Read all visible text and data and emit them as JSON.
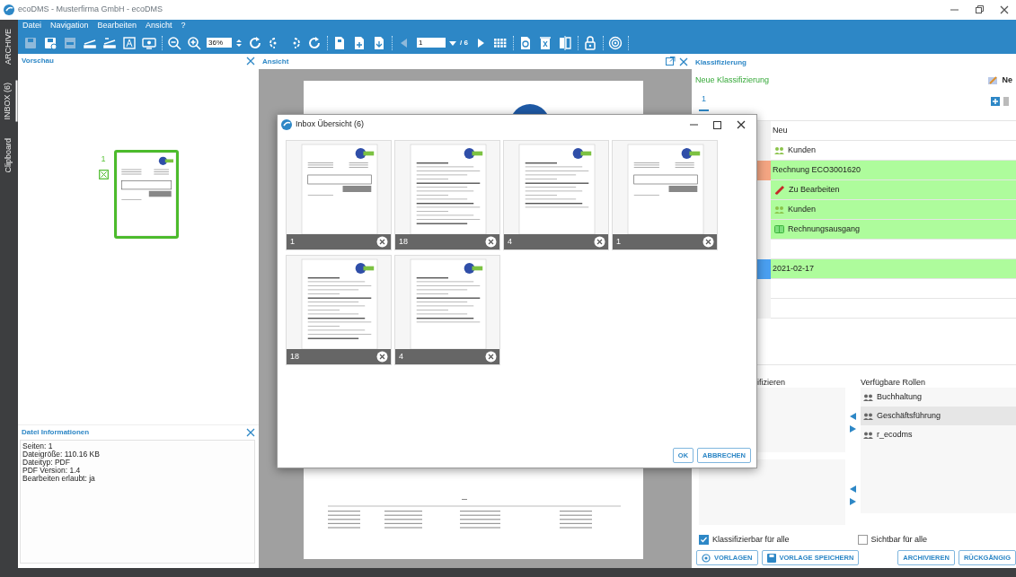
{
  "window": {
    "title": "ecoDMS - Musterfirma GmbH - ecoDMS"
  },
  "side_tabs": [
    {
      "label": "ARCHIVE",
      "selected": false
    },
    {
      "label": "INBOX (6)",
      "selected": true
    },
    {
      "label": "Clipboard",
      "selected": false
    }
  ],
  "menu": [
    "Datei",
    "Navigation",
    "Bearbeiten",
    "Ansicht",
    "?"
  ],
  "toolbar": {
    "groups": [
      [
        {
          "kind": "save",
          "disabled": true
        },
        {
          "kind": "save-as",
          "disabled": false
        },
        {
          "kind": "pdf",
          "disabled": true
        },
        {
          "kind": "scan",
          "disabled": false
        },
        {
          "kind": "scan-add",
          "disabled": false
        },
        {
          "kind": "ocr",
          "disabled": false
        },
        {
          "kind": "screen",
          "disabled": false
        }
      ],
      [
        {
          "kind": "zoom-out",
          "disabled": false
        },
        {
          "kind": "zoom-in",
          "disabled": false
        },
        {
          "kind": "zoom-field",
          "value": "36%",
          "disabled": false
        },
        {
          "kind": "fit",
          "disabled": false
        },
        {
          "kind": "rotate-left",
          "disabled": false
        },
        {
          "kind": "rotate-right",
          "disabled": false
        },
        {
          "kind": "refresh",
          "disabled": false
        }
      ],
      [
        {
          "kind": "doc",
          "disabled": false
        },
        {
          "kind": "doc-add",
          "disabled": false
        },
        {
          "kind": "doc-export",
          "disabled": false
        }
      ],
      [
        {
          "kind": "prev",
          "disabled": true
        },
        {
          "kind": "page-field",
          "value": "1",
          "total": "/ 6",
          "disabled": false
        },
        {
          "kind": "next",
          "disabled": false
        },
        {
          "kind": "grid",
          "disabled": false
        }
      ],
      [
        {
          "kind": "restore",
          "disabled": false
        },
        {
          "kind": "delete",
          "disabled": false
        },
        {
          "kind": "split",
          "disabled": false
        }
      ],
      [
        {
          "kind": "lock",
          "disabled": false
        }
      ],
      [
        {
          "kind": "target",
          "disabled": false
        }
      ]
    ]
  },
  "preview": {
    "title": "Vorschau",
    "thumbnails": [
      {
        "label": "1",
        "selected": true
      }
    ]
  },
  "file_info": {
    "title": "Datei Informationen",
    "lines": [
      "Seiten: 1",
      "Dateigröße: 110.16 KB",
      "Dateityp: PDF",
      "PDF Version: 1.4",
      "Bearbeiten erlaubt: ja"
    ]
  },
  "view": {
    "title": "Ansicht"
  },
  "classification": {
    "title": "Klassifizierung",
    "new_label": "Neue Klassifizierung",
    "new_button": "Ne",
    "tabs": [
      {
        "label": "1",
        "selected": true
      }
    ],
    "rows": [
      {
        "kind": "text",
        "value": "Neu",
        "filled": false
      },
      {
        "kind": "group",
        "value": "Kunden",
        "filled": false
      },
      {
        "kind": "text",
        "value": "Rechnung ECO3001620",
        "filled": true,
        "color": "#f4a582"
      },
      {
        "kind": "edit",
        "value": "Zu Bearbeiten",
        "filled": true
      },
      {
        "kind": "group",
        "value": "Kunden",
        "filled": true
      },
      {
        "kind": "folder",
        "value": "Rechnungsausgang",
        "filled": true
      },
      {
        "kind": "empty",
        "filled": false
      },
      {
        "kind": "text",
        "value": "2021-02-17",
        "filled": true,
        "color": "#4a9ff0"
      },
      {
        "kind": "empty",
        "filled": false
      },
      {
        "kind": "empty",
        "filled": false
      }
    ]
  },
  "rights": {
    "label": "ifizieren",
    "roles_title": "Verfügbare Rollen",
    "roles": [
      {
        "label": "Buchhaltung",
        "selected": false
      },
      {
        "label": "Geschäftsführung",
        "selected": true
      },
      {
        "label": "r_ecodms",
        "selected": false
      }
    ],
    "checks": [
      {
        "label": "Klassifizierbar für alle",
        "checked": true
      },
      {
        "label": "Sichtbar für alle",
        "checked": false
      }
    ]
  },
  "buttons": [
    {
      "kind": "templates",
      "label": "VORLAGEN"
    },
    {
      "kind": "save-template",
      "label": "VORLAGE SPEICHERN"
    },
    {
      "kind": "plain",
      "label": "ARCHIVIEREN"
    },
    {
      "kind": "plain",
      "label": "RÜCKGÄNGIG"
    }
  ],
  "dialog": {
    "title": "Inbox Übersicht (6)",
    "documents": [
      {
        "pages": "1",
        "kind": "invoice"
      },
      {
        "pages": "18",
        "kind": "terms"
      },
      {
        "pages": "4",
        "kind": "withdrawal"
      },
      {
        "pages": "1",
        "kind": "invoice"
      },
      {
        "pages": "18",
        "kind": "terms"
      },
      {
        "pages": "4",
        "kind": "withdrawal"
      }
    ],
    "buttons": [
      "OK",
      "ABBRECHEN"
    ]
  }
}
